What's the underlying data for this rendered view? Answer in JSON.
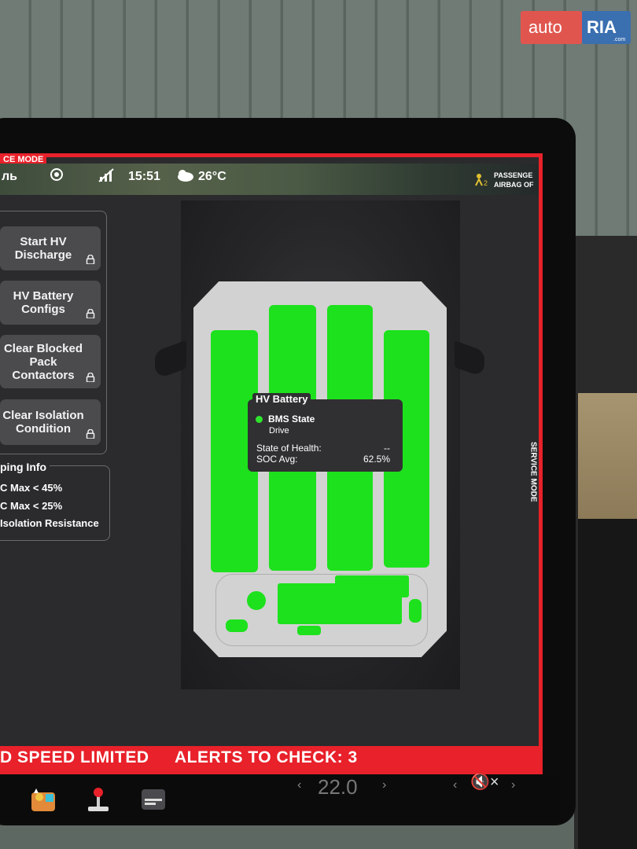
{
  "watermark": {
    "brand_a": "auto",
    "brand_b": "RIA",
    "brand_c": ".com"
  },
  "header": {
    "mode_tag": "CE MODE",
    "side_mode": "SERVICE MODE"
  },
  "status_bar": {
    "location_partial": "ль",
    "time": "15:51",
    "temperature": "26°C",
    "airbag_line1": "PASSENGE",
    "airbag_line2": "AIRBAG OF",
    "airbag_icon_text": "2"
  },
  "left_panel": {
    "buttons": [
      {
        "label_l1": "Start HV",
        "label_l2": "Discharge",
        "label_l3": ""
      },
      {
        "label_l1": "HV Battery",
        "label_l2": "Configs",
        "label_l3": ""
      },
      {
        "label_l1": "Clear Blocked",
        "label_l2": "Pack",
        "label_l3": "Contactors"
      },
      {
        "label_l1": "Clear Isolation",
        "label_l2": "Condition",
        "label_l3": ""
      }
    ],
    "info": {
      "title": "ping Info",
      "lines": [
        "C Max < 45%",
        "C Max < 25%",
        "Isolation Resistance"
      ]
    }
  },
  "hv_battery": {
    "title": "HV Battery",
    "bms_label": "BMS State",
    "bms_value": "Drive",
    "soh_label": "State of Health:",
    "soh_value": "--",
    "soc_label": "SOC Avg:",
    "soc_value": "62.5%",
    "module_color": "#1de11d"
  },
  "alerts": {
    "speed": "D   SPEED LIMITED",
    "check": "ALERTS TO CHECK: 3"
  },
  "dock": {
    "temperature": "22.0",
    "chevron_left": "‹",
    "chevron_right": "›",
    "volume_icon": "🔇×"
  },
  "colors": {
    "accent_red": "#e8212a",
    "panel_bg": "#2b2b2d",
    "button_bg": "#4b4b4e"
  }
}
